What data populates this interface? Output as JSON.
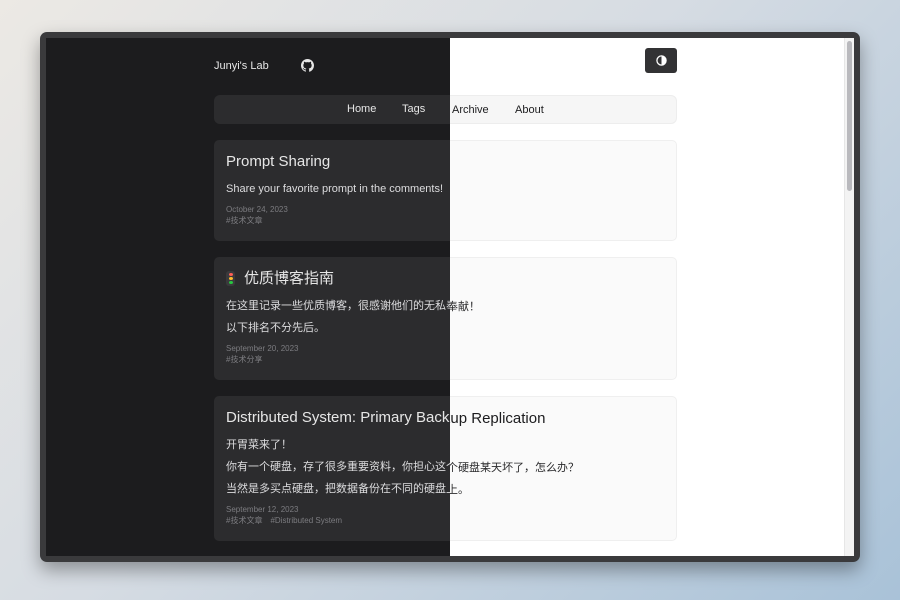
{
  "site": {
    "title": "Junyi's Lab"
  },
  "icons": {
    "github": "github-icon",
    "theme_toggle": "contrast-icon",
    "post_emoji": "traffic-light-icon"
  },
  "nav": {
    "items": [
      "Home",
      "Tags",
      "Archive",
      "About"
    ]
  },
  "posts": [
    {
      "title": "Prompt Sharing",
      "paragraphs": [
        "Share your favorite prompt in the comments!"
      ],
      "date": "October 24, 2023",
      "tags": [
        "#技术文章"
      ]
    },
    {
      "title": "优质博客指南",
      "paragraphs": [
        "在这里记录一些优质博客，很感谢他们的无私奉献！",
        "以下排名不分先后。"
      ],
      "date": "September 20, 2023",
      "tags": [
        "#技术分享"
      ]
    },
    {
      "title": "Distributed System: Primary Backup Replication",
      "paragraphs": [
        "开胃菜来了！",
        "你有一个硬盘，存了很多重要资料，你担心这个硬盘某天坏了，怎么办？",
        "当然是多买点硬盘，把数据备份在不同的硬盘上。"
      ],
      "date": "September 12, 2023",
      "tags": [
        "#技术文章",
        "#Distributed System"
      ]
    }
  ],
  "colors": {
    "dark_bg": "#1c1c1e",
    "dark_card": "#2c2c2e",
    "light_bg": "#ffffff",
    "light_card": "#fafafa",
    "frame": "#3a3a3c"
  }
}
